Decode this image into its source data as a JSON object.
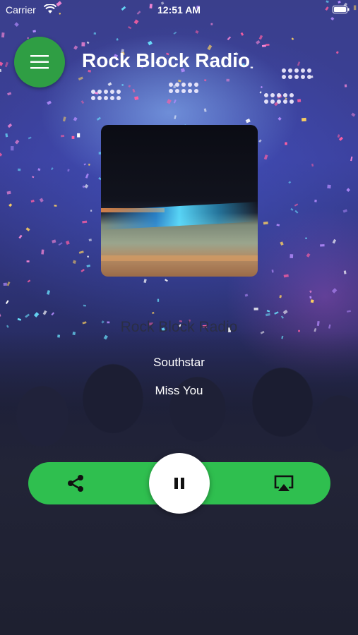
{
  "status_bar": {
    "carrier": "Carrier",
    "time": "12:51 AM",
    "icons": [
      "wifi-icon",
      "battery-icon"
    ]
  },
  "header": {
    "title": "Rock Block Radio",
    "menu_icon": "hamburger-menu-icon"
  },
  "now_playing": {
    "station": "Rock Block Radio",
    "artist": "Southstar",
    "song": "Miss You"
  },
  "controls": {
    "share_icon": "share-icon",
    "play_state_icon": "pause-icon",
    "airplay_icon": "airplay-icon"
  },
  "colors": {
    "accent_green": "#2fbf4f",
    "menu_green": "#2f9e44"
  }
}
